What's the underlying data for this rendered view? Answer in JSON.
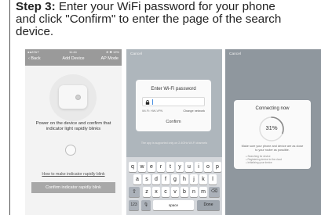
{
  "caption": {
    "step_label": "Step 3:",
    "line1_rest": " Enter your WiFi password for your phone",
    "line2": "and click \"Confirm\" to enter the page of the search",
    "line3": "device."
  },
  "phone1": {
    "status_left": "●●AT&T",
    "status_time": "11:44",
    "status_right": "⊕ ✱ 19%",
    "back_label": "‹ Back",
    "title": "Add Device",
    "mode_label": "AP Mode",
    "instruction": "Power on the device and confirm that indicator light rapidly blinks",
    "link": "How to make indicator rapidly blink",
    "button": "Confirm indicator rapidly blink"
  },
  "phone2": {
    "cancel": "Cancel",
    "dialog_title": "Enter Wi-Fi password",
    "wifi_name": "Wi-Fi: HW-VPN",
    "change_network": "Change network",
    "confirm": "Confirm",
    "note": "The app is supported only on 2.4GHz Wi-Fi channels",
    "keyboard": {
      "row1": [
        "q",
        "w",
        "e",
        "r",
        "t",
        "y",
        "u",
        "i",
        "o",
        "p"
      ],
      "row2": [
        "a",
        "s",
        "d",
        "f",
        "g",
        "h",
        "j",
        "k",
        "l"
      ],
      "row3": [
        "z",
        "x",
        "c",
        "v",
        "b",
        "n",
        "m"
      ],
      "shift": "⇧",
      "backspace": "⌫",
      "numbers": "123",
      "mic": "🎙",
      "space": "space",
      "done": "Done"
    }
  },
  "phone3": {
    "cancel": "Cancel",
    "title": "Connecting now",
    "percent": "31%",
    "progress": 0.31,
    "info": "Make sure your phone and device are as close to your router as possible.",
    "steps": [
      "Searching for device",
      "Registering device to the cloud",
      "Initializing your device"
    ]
  },
  "colors": {
    "accent": "#4a90e2",
    "progress_track": "#dddddd",
    "progress_arc": "#888888"
  }
}
